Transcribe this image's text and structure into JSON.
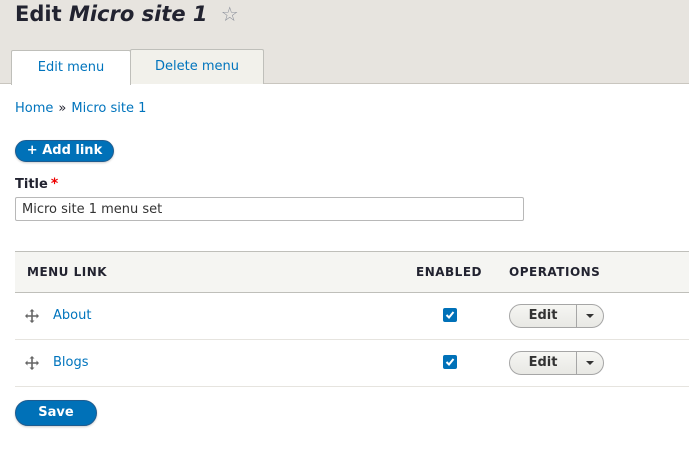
{
  "page": {
    "title_prefix": "Edit",
    "title_name": "Micro site 1",
    "star_glyph": "☆"
  },
  "tabs": [
    {
      "label": "Edit menu",
      "active": true
    },
    {
      "label": "Delete menu",
      "active": false
    }
  ],
  "breadcrumb": {
    "home": "Home",
    "separator": "»",
    "current": "Micro site 1"
  },
  "actions": {
    "add_link": "+ Add link",
    "save": "Save"
  },
  "form": {
    "title_label": "Title",
    "required_marker": "*",
    "title_value": "Micro site 1 menu set"
  },
  "table": {
    "headers": {
      "menu_link": "MENU LINK",
      "enabled": "ENABLED",
      "operations": "OPERATIONS"
    },
    "rows": [
      {
        "label": "About",
        "enabled": true,
        "op_label": "Edit"
      },
      {
        "label": "Blogs",
        "enabled": true,
        "op_label": "Edit"
      }
    ]
  },
  "colors": {
    "header_bg": "#e7e4df",
    "link": "#0074bd",
    "primary_button": "#0071b8",
    "required": "#ee0000"
  }
}
